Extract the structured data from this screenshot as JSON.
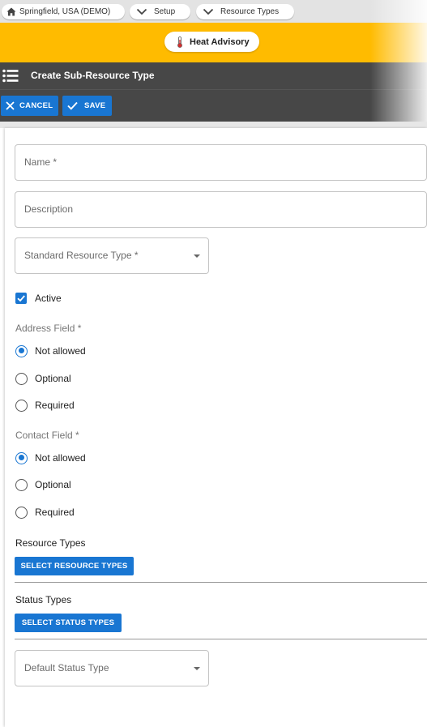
{
  "breadcrumbs": {
    "site": "Springfield, USA (DEMO)",
    "setup": "Setup",
    "resource_types": "Resource Types"
  },
  "alert": {
    "label": "Heat Advisory"
  },
  "header": {
    "title": "Create Sub-Resource Type"
  },
  "toolbar": {
    "cancel_label": "CANCEL",
    "save_label": "SAVE"
  },
  "form": {
    "name_placeholder": "Name *",
    "description_placeholder": "Description",
    "standard_type_placeholder": "Standard Resource Type *",
    "active_label": "Active",
    "active_checked": true,
    "address_field": {
      "label": "Address Field *",
      "options": [
        "Not allowed",
        "Optional",
        "Required"
      ],
      "selected": "Not allowed"
    },
    "contact_field": {
      "label": "Contact Field *",
      "options": [
        "Not allowed",
        "Optional",
        "Required"
      ],
      "selected": "Not allowed"
    },
    "resource_types_label": "Resource Types",
    "select_resource_types_button": "SELECT RESOURCE TYPES",
    "status_types_label": "Status Types",
    "select_status_types_button": "SELECT STATUS TYPES",
    "default_status_placeholder": "Default Status Type"
  },
  "colors": {
    "primary": "#1976d2",
    "banner": "#ffbb00",
    "header": "#474747"
  }
}
